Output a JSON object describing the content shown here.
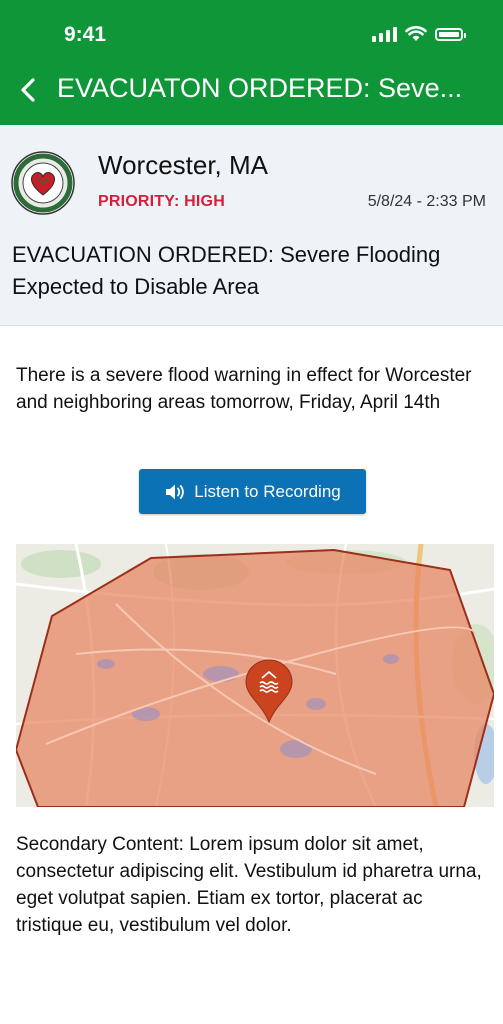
{
  "status_bar": {
    "time": "9:41"
  },
  "nav": {
    "title": "EVACUATON ORDERED: Seve..."
  },
  "alert": {
    "city": "Worcester, MA",
    "priority": "PRIORITY: HIGH",
    "datetime": "5/8/24 - 2:33 PM",
    "headline": "EVACUATION ORDERED: Severe Flooding Expected to Disable Area",
    "body": "There is a severe flood warning in effect for Worcester and neighboring areas tomorrow, Friday, April 14th",
    "listen_label": "Listen to Recording",
    "secondary": "Secondary Content: Lorem ipsum dolor sit amet, consectetur adipiscing elit. Vestibulum id pharetra urna, eget volutpat sapien. Etiam ex tortor, placerat ac tristique eu, vestibulum vel dolor."
  },
  "colors": {
    "header_green": "#0f9639",
    "priority_red": "#d41f3a",
    "button_blue": "#0a72b5",
    "zone_fill": "#e8835f",
    "pin": "#c9441f"
  },
  "icons": {
    "back": "chevron-left-icon",
    "audio": "speaker-icon",
    "pin": "flood-pin-icon"
  }
}
